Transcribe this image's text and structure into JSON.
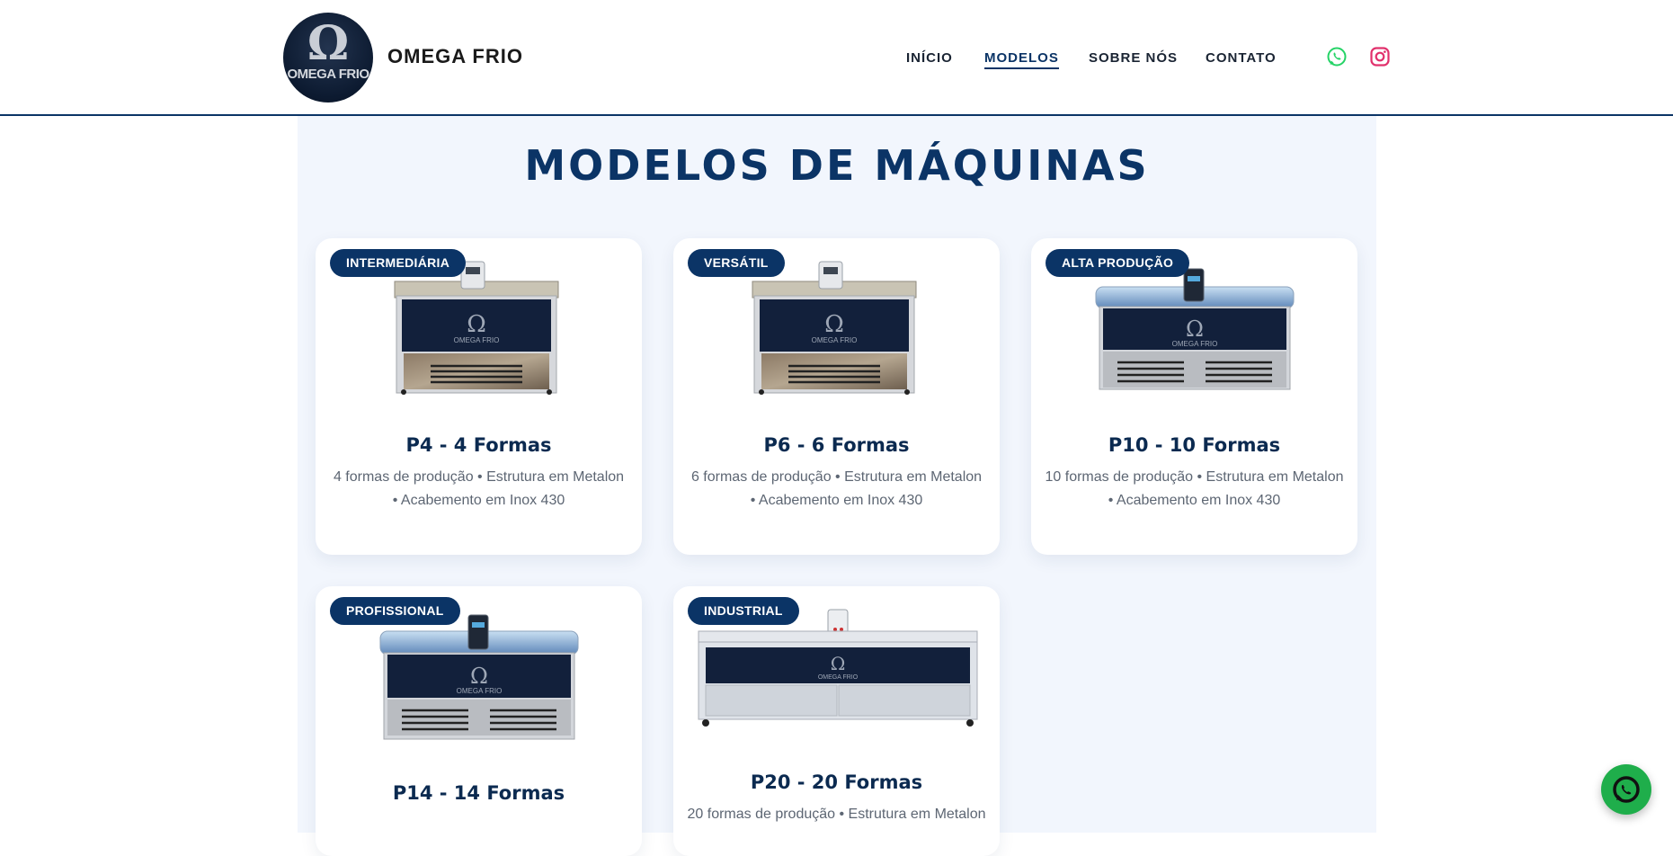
{
  "brand": {
    "logo_text": "OMEGA FRIO",
    "logo_symbol": "Ω",
    "name": "OMEGA FRIO"
  },
  "nav": [
    {
      "label": "INÍCIO",
      "active": false
    },
    {
      "label": "MODELOS",
      "active": true
    },
    {
      "label": "SOBRE NÓS",
      "active": false
    },
    {
      "label": "CONTATO",
      "active": false
    }
  ],
  "social": {
    "whatsapp_icon": "whatsapp-icon",
    "instagram_icon": "instagram-icon"
  },
  "section": {
    "title": "MODELOS DE MÁQUINAS"
  },
  "machine_label": {
    "symbol": "Ω",
    "text": "OMEGA FRIO"
  },
  "models": [
    {
      "badge": "INTERMEDIÁRIA",
      "title": "P4 - 4 Formas",
      "desc_1": "4 formas de produção • Estrutura em Metalon",
      "desc_2": "• Acabemento em Inox 430"
    },
    {
      "badge": "VERSÁTIL",
      "title": "P6 - 6 Formas",
      "desc_1": "6 formas de produção • Estrutura em Metalon",
      "desc_2": "• Acabemento em Inox 430"
    },
    {
      "badge": "ALTA PRODUÇÃO",
      "title": "P10 - 10 Formas",
      "desc_1": "10 formas de produção • Estrutura em Metalon",
      "desc_2": "• Acabemento em Inox 430"
    },
    {
      "badge": "PROFISSIONAL",
      "title": "P14 - 14 Formas",
      "desc_1": "",
      "desc_2": ""
    },
    {
      "badge": "INDUSTRIAL",
      "title": "P20 - 20 Formas",
      "desc_1": "20 formas de produção • Estrutura em Metalon",
      "desc_2": ""
    }
  ],
  "colors": {
    "primary": "#0b3466",
    "whatsapp": "#25d366",
    "instagram": "#e1306c",
    "section_bg": "#f2f6fd"
  },
  "floating": {
    "icon": "whatsapp-icon"
  }
}
